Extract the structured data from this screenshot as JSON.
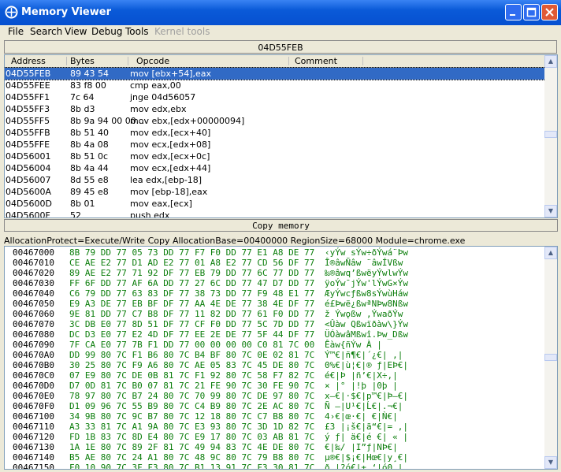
{
  "window": {
    "title": "Memory Viewer"
  },
  "menu": [
    "File",
    "Search",
    "View",
    "Debug",
    "Tools",
    "Kernel tools"
  ],
  "address_bar": "04D55FEB",
  "disasm": {
    "columns": [
      "Address",
      "Bytes",
      "Opcode",
      "Comment"
    ],
    "rows": [
      {
        "address": "04D55FEB",
        "bytes": "89 43 54",
        "opcode": "mov [ebx+54],eax"
      },
      {
        "address": "04D55FEE",
        "bytes": "83 f8 00",
        "opcode": "cmp eax,00"
      },
      {
        "address": "04D55FF1",
        "bytes": "7c 64",
        "opcode": "jnge 04d56057"
      },
      {
        "address": "04D55FF3",
        "bytes": "8b d3",
        "opcode": "mov edx,ebx"
      },
      {
        "address": "04D55FF5",
        "bytes": "8b 9a 94 00 00...",
        "opcode": "mov ebx,[edx+00000094]"
      },
      {
        "address": "04D55FFB",
        "bytes": "8b 51 40",
        "opcode": "mov edx,[ecx+40]"
      },
      {
        "address": "04D55FFE",
        "bytes": "8b 4a 08",
        "opcode": "mov ecx,[edx+08]"
      },
      {
        "address": "04D56001",
        "bytes": "8b 51 0c",
        "opcode": "mov edx,[ecx+0c]"
      },
      {
        "address": "04D56004",
        "bytes": "8b 4a 44",
        "opcode": "mov ecx,[edx+44]"
      },
      {
        "address": "04D56007",
        "bytes": "8d 55 e8",
        "opcode": "lea edx,[ebp-18]"
      },
      {
        "address": "04D5600A",
        "bytes": "89 45 e8",
        "opcode": "mov [ebp-18],eax"
      },
      {
        "address": "04D5600D",
        "bytes": "8b 01",
        "opcode": "mov eax,[ecx]"
      },
      {
        "address": "04D5600F",
        "bytes": "52",
        "opcode": "push edx"
      }
    ]
  },
  "copy_button": "Copy memory",
  "info_line": "AllocationProtect=Execute/Write Copy  AllocationBase=00400000 RegionSize=68000 Module=chrome.exe",
  "hex": {
    "rows": [
      {
        "addr": "00467000",
        "bytes": "8B 79 DD 77 05 73 DD 77 F7 F0 DD 77 E1 A8 DE 77",
        "ascii": "‹yÝw sÝw÷ðÝwá¨Þw"
      },
      {
        "addr": "00467010",
        "bytes": "CE AE E2 77 D1 AD E2 77 01 A8 E2 77 CD 56 DF 77",
        "ascii": "Î®âwÑ­âw ¨âwÍVßw"
      },
      {
        "addr": "00467020",
        "bytes": "89 AE E2 77 71 92 DF 77 EB 79 DD 77 6C 77 DD 77",
        "ascii": "‰®âwq’ßwëyÝwlwÝw"
      },
      {
        "addr": "00467030",
        "bytes": "FF 6F DD 77 AF 6A DD 77 27 6C DD 77 47 D7 DD 77",
        "ascii": "ÿoÝw¯jÝw'lÝwG×Ýw"
      },
      {
        "addr": "00467040",
        "bytes": "C6 79 DD 77 63 83 DF 77 38 73 DD 77 F9 48 E1 77",
        "ascii": "ÆyÝwcƒßw8sÝwùHáw"
      },
      {
        "addr": "00467050",
        "bytes": "E9 A3 DE 77 EB BF DF 77 AA 4E DE 77 38 4E DF 77",
        "ascii": "é£Þwë¿ßwªNÞw8Nßw"
      },
      {
        "addr": "00467060",
        "bytes": "9E 81 DD 77 C7 B8 DF 77 11 82 DD 77 61 F0 DD 77",
        "ascii": "ž Ýwǫßw ‚ÝwaðÝw"
      },
      {
        "addr": "00467070",
        "bytes": "3C DB E0 77 8D 51 DF 77 CF F0 DD 77 5C 7D DD 77",
        "ascii": "<Ûàw Qßwïðàw\\}Ýw"
      },
      {
        "addr": "00467080",
        "bytes": "DC D3 E0 77 E2 4D DF 77 EE 2E DE 77 5F 44 DF 77",
        "ascii": "ÜÓàwâMßwî.Þw_Dßw"
      },
      {
        "addr": "00467090",
        "bytes": "7F CA E0 77 7B F1 DD 77 00 00 00 00 C0 81 7C 00",
        "ascii": " Êàw{ñÝw    À |"
      },
      {
        "addr": "004670A0",
        "bytes": "DD 99 80 7C F1 B6 80 7C B4 BF 80 7C 0E 02 81 7C",
        "ascii": "Ý™€|ñ¶€|´¿€| ‚|"
      },
      {
        "addr": "004670B0",
        "bytes": "30 25 80 7C F9 A6 80 7C AE 05 83 7C 45 DE 80 7C",
        "ascii": "0%€|ù¦€|® ƒ|EÞ€|"
      },
      {
        "addr": "004670C0",
        "bytes": "07 E9 80 7C DE 0B 81 7C F1 92 80 7C 58 F7 82 7C",
        "ascii": " é€|Þ |ñ’€|X÷‚|"
      },
      {
        "addr": "004670D0",
        "bytes": "D7 0D 81 7C B0 07 81 7C 21 FE 90 7C 30 FE 90 7C",
        "ascii": "× |° |!þ |0þ |"
      },
      {
        "addr": "004670E0",
        "bytes": "78 97 80 7C B7 24 80 7C 70 99 80 7C DE 97 80 7C",
        "ascii": "x—€|·$€|p™€|Þ—€|"
      },
      {
        "addr": "004670F0",
        "bytes": "D1 09 96 7C 55 B9 80 7C C4 B9 80 7C 2E AC 80 7C",
        "ascii": "Ñ –|U¹€|Ĺ€|.¬€|"
      },
      {
        "addr": "00467100",
        "bytes": "34 9B 80 7C 9C B7 80 7C 12 18 80 7C C7 B8 80 7C",
        "ascii": "4›€|œ·€|  €|Ǹ€|"
      },
      {
        "addr": "00467110",
        "bytes": "A3 33 81 7C A1 9A 80 7C E3 93 80 7C 3D 1D 82 7C",
        "ascii": "£3 |¡š€|ã“€|= ‚|"
      },
      {
        "addr": "00467120",
        "bytes": "FD 1B 83 7C 8D E4 80 7C E9 17 80 7C 03 AB 81 7C",
        "ascii": "ý ƒ| ä€|é €| « |"
      },
      {
        "addr": "00467130",
        "bytes": "1A 1E 80 7C 89 2F 81 7C 49 94 83 7C 4E DE 80 7C",
        "ascii": "  €|‰/ |I”ƒ|NÞ€|"
      },
      {
        "addr": "00467140",
        "bytes": "B5 AE 80 7C 24 A1 80 7C 48 9C 80 7C 79 B8 80 7C",
        "ascii": "µ®€|$¡€|Hœ€|y¸€|"
      },
      {
        "addr": "00467150",
        "bytes": "F0 10 90 7C 3F F3 80 7C B1 13 91 7C F3 30 81 7C",
        "ascii": "ð  |?ó€|± ‘|ó0 |"
      }
    ]
  },
  "colors": {
    "title_blue": "#0a5ad8",
    "selection": "#316ac5",
    "hex_green": "#0a7d0a",
    "close_red": "#e05a35"
  }
}
